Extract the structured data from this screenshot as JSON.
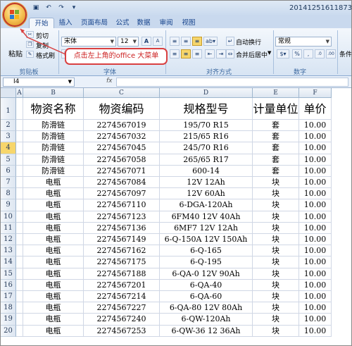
{
  "window": {
    "title": "20141251611873"
  },
  "qat": {
    "save_icon": "save-icon",
    "undo_icon": "undo-icon",
    "redo_icon": "redo-icon",
    "customize_icon": "customize-icon"
  },
  "tabs": [
    {
      "label": "开始",
      "active": true
    },
    {
      "label": "插入",
      "active": false
    },
    {
      "label": "页面布局",
      "active": false
    },
    {
      "label": "公式",
      "active": false
    },
    {
      "label": "数据",
      "active": false
    },
    {
      "label": "审阅",
      "active": false
    },
    {
      "label": "视图",
      "active": false
    }
  ],
  "ribbon": {
    "clipboard": {
      "paste": "粘贴",
      "cut": "剪切",
      "copy": "复制",
      "format_painter": "格式刷",
      "group_label": "剪贴板"
    },
    "font": {
      "font_name": "宋体",
      "font_size": "12",
      "bold": "B",
      "italic": "I",
      "underline": "U",
      "grow": "A",
      "shrink": "A",
      "group_label": "字体"
    },
    "alignment": {
      "wrap_text": "自动换行",
      "merge_center": "合并后居中",
      "group_label": "对齐方式"
    },
    "number": {
      "format": "常规",
      "percent": "%",
      "comma": ",",
      "group_label": "数字"
    },
    "styles": {
      "conditional_format": "条件"
    }
  },
  "callout": {
    "text": "点击左上角的office 大菜单"
  },
  "formula_bar": {
    "name_box": "I4",
    "fx": "fx",
    "value": ""
  },
  "columns": [
    "A",
    "B",
    "C",
    "D",
    "E",
    "F"
  ],
  "sheet": {
    "header_row": [
      "物资名称",
      "物资编码",
      "规格型号",
      "计量单位",
      "单价"
    ],
    "rows": [
      [
        "防滑链",
        "2274567019",
        "195/70 R15",
        "套",
        "10.00"
      ],
      [
        "防滑链",
        "2274567032",
        "215/65 R16",
        "套",
        "10.00"
      ],
      [
        "防滑链",
        "2274567045",
        "245/70 R16",
        "套",
        "10.00"
      ],
      [
        "防滑链",
        "2274567058",
        "265/65 R17",
        "套",
        "10.00"
      ],
      [
        "防滑链",
        "2274567071",
        "600-14",
        "套",
        "10.00"
      ],
      [
        "电瓶",
        "2274567084",
        "12V 12Ah",
        "块",
        "10.00"
      ],
      [
        "电瓶",
        "2274567097",
        "12V 60Ah",
        "块",
        "10.00"
      ],
      [
        "电瓶",
        "2274567110",
        "6-DGA-120Ah",
        "块",
        "10.00"
      ],
      [
        "电瓶",
        "2274567123",
        "6FM40 12V 40Ah",
        "块",
        "10.00"
      ],
      [
        "电瓶",
        "2274567136",
        "6MF7 12V 12Ah",
        "块",
        "10.00"
      ],
      [
        "电瓶",
        "2274567149",
        "6-Q-150A 12V 150Ah",
        "块",
        "10.00"
      ],
      [
        "电瓶",
        "2274567162",
        "6-Q-165",
        "块",
        "10.00"
      ],
      [
        "电瓶",
        "2274567175",
        "6-Q-195",
        "块",
        "10.00"
      ],
      [
        "电瓶",
        "2274567188",
        "6-QA-0 12V 90Ah",
        "块",
        "10.00"
      ],
      [
        "电瓶",
        "2274567201",
        "6-QA-40",
        "块",
        "10.00"
      ],
      [
        "电瓶",
        "2274567214",
        "6-QA-60",
        "块",
        "10.00"
      ],
      [
        "电瓶",
        "2274567227",
        "6-QA-80 12V 80Ah",
        "块",
        "10.00"
      ],
      [
        "电瓶",
        "2274567240",
        "6-QW-120Ah",
        "块",
        "10.00"
      ],
      [
        "电瓶",
        "2274567253",
        "6-QW-36 12 36Ah",
        "块",
        "10.00"
      ]
    ]
  },
  "row_numbers": [
    "1",
    "2",
    "3",
    "4",
    "5",
    "6",
    "7",
    "8",
    "9",
    "10",
    "11",
    "12",
    "13",
    "14",
    "15",
    "16",
    "17",
    "18",
    "19",
    "20"
  ],
  "selected_row": "4",
  "colors": {
    "accent": "#15428b",
    "callout_border": "#d94040",
    "callout_text": "#cc1f1f",
    "selection": "#f7d66b"
  }
}
